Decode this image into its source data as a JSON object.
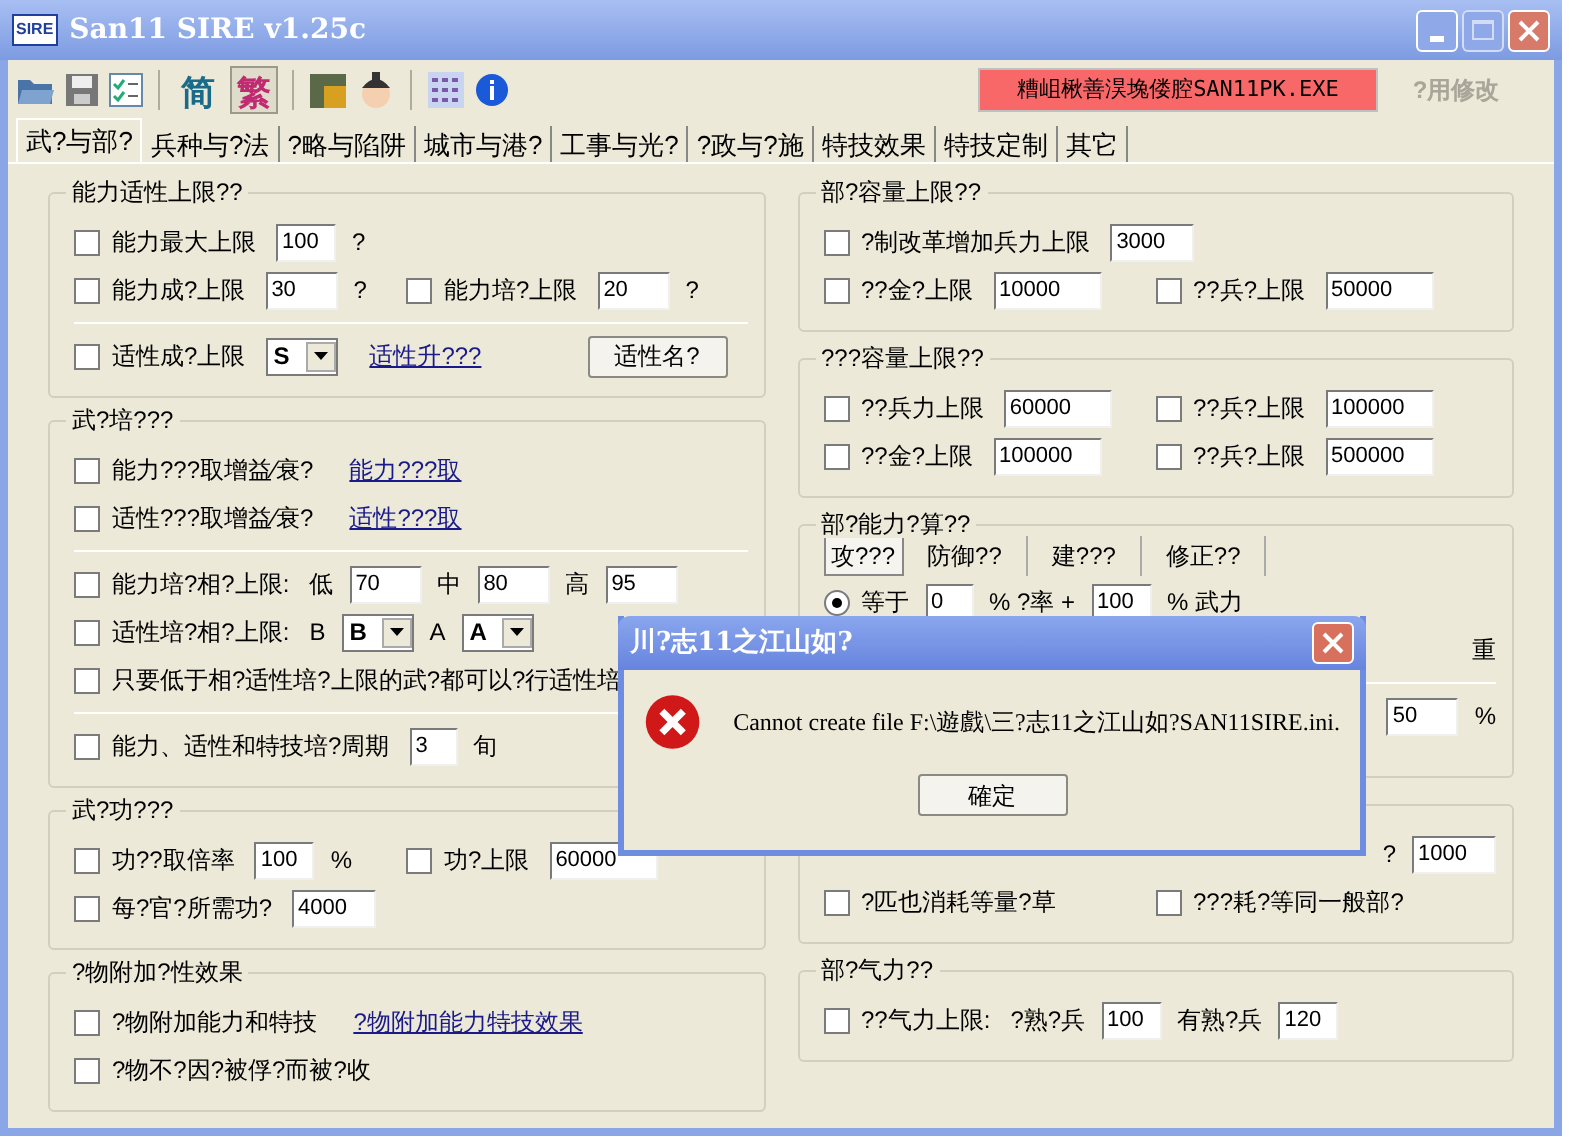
{
  "window": {
    "app_icon": "SIRE",
    "title": "San11 SIRE v1.25c"
  },
  "toolbar": {
    "script_buttons": [
      {
        "text": "简",
        "selected": false
      },
      {
        "text": "繁",
        "selected": true
      }
    ],
    "status_label": "糟岨楸善淏堍偻腔SAN11PK.EXE",
    "apply_button": {
      "label": "?用修改",
      "disabled": true
    }
  },
  "tabs": [
    {
      "label": "武?与部?",
      "selected": true
    },
    {
      "label": "兵种与?法",
      "selected": false
    },
    {
      "label": "?略与陷阱",
      "selected": false
    },
    {
      "label": "城市与港?",
      "selected": false
    },
    {
      "label": "工事与光?",
      "selected": false
    },
    {
      "label": "?政与?施",
      "selected": false
    },
    {
      "label": "特技效果",
      "selected": false
    },
    {
      "label": "特技定制",
      "selected": false
    },
    {
      "label": "其它",
      "selected": false
    }
  ],
  "left_groups": [
    {
      "title": "能力适性上限??",
      "rows": [
        {
          "cells": [
            [
              {
                "kind": "check",
                "label": "能力最大上限",
                "checked": false
              },
              {
                "kind": "field",
                "value": "100"
              },
              {
                "kind": "text",
                "text": "?"
              }
            ]
          ]
        },
        {
          "cells": [
            [
              {
                "kind": "check",
                "label": "能力成?上限",
                "checked": false
              },
              {
                "kind": "field",
                "value": "30"
              },
              {
                "kind": "text",
                "text": "?"
              }
            ],
            [
              {
                "kind": "check",
                "label": "能力培?上限",
                "checked": false
              },
              {
                "kind": "field",
                "value": "20"
              },
              {
                "kind": "text",
                "text": "?"
              }
            ]
          ]
        },
        {
          "kind": "divider"
        },
        {
          "cells": [
            [
              {
                "kind": "check",
                "label": "适性成?上限",
                "checked": false
              },
              {
                "kind": "select",
                "value": "S"
              },
              {
                "kind": "link",
                "text": "适性升???"
              },
              {
                "kind": "button",
                "label": "适性名?"
              }
            ]
          ]
        }
      ]
    },
    {
      "title": "武?培???",
      "rows": [
        {
          "cells": [
            [
              {
                "kind": "check",
                "label": "能力???取增益⁄衰?",
                "checked": false
              },
              {
                "kind": "link",
                "text": "能力???取"
              }
            ]
          ]
        },
        {
          "cells": [
            [
              {
                "kind": "check",
                "label": "适性???取增益⁄衰?",
                "checked": false
              },
              {
                "kind": "link",
                "text": "适性???取"
              }
            ]
          ]
        },
        {
          "kind": "divider"
        },
        {
          "cells": [
            [
              {
                "kind": "check",
                "label": "能力培?相?上限:",
                "checked": false
              },
              {
                "kind": "text",
                "text": "低"
              },
              {
                "kind": "field",
                "value": "70"
              },
              {
                "kind": "text",
                "text": "中"
              },
              {
                "kind": "field",
                "value": "80"
              },
              {
                "kind": "text",
                "text": "高"
              },
              {
                "kind": "field",
                "value": "95"
              }
            ]
          ]
        },
        {
          "cells": [
            [
              {
                "kind": "check",
                "label": "适性培?相?上限:",
                "checked": false
              },
              {
                "kind": "text",
                "text": "B"
              },
              {
                "kind": "select",
                "value": "B"
              },
              {
                "kind": "text",
                "text": "A"
              },
              {
                "kind": "select",
                "value": "A"
              }
            ]
          ]
        },
        {
          "cells": [
            [
              {
                "kind": "check",
                "label": "只要低于相?适性培?上限的武?都可以?行适性培",
                "checked": false
              }
            ]
          ]
        },
        {
          "kind": "divider"
        },
        {
          "cells": [
            [
              {
                "kind": "check",
                "label": "能力、适性和特技培?周期",
                "checked": false
              },
              {
                "kind": "field",
                "value": "3"
              },
              {
                "kind": "text",
                "text": "旬"
              }
            ]
          ]
        }
      ]
    },
    {
      "title": "武?功???",
      "rows": [
        {
          "cells": [
            [
              {
                "kind": "check",
                "label": "功??取倍率",
                "checked": false
              },
              {
                "kind": "field",
                "value": "100"
              },
              {
                "kind": "text",
                "text": "%"
              }
            ],
            [
              {
                "kind": "check",
                "label": "功?上限",
                "checked": false
              },
              {
                "kind": "field",
                "value": "60000"
              }
            ]
          ]
        },
        {
          "cells": [
            [
              {
                "kind": "check",
                "label": "每?官?所需功?",
                "checked": false
              },
              {
                "kind": "field",
                "value": "4000"
              }
            ]
          ]
        }
      ]
    },
    {
      "title": "?物附加?性效果",
      "rows": [
        {
          "cells": [
            [
              {
                "kind": "check",
                "label": "?物附加能力和特技",
                "checked": false
              },
              {
                "kind": "link",
                "text": "?物附加能力特技效果"
              }
            ]
          ]
        },
        {
          "cells": [
            [
              {
                "kind": "check",
                "label": "?物不?因?被俘?而被?收",
                "checked": false
              }
            ]
          ]
        }
      ]
    }
  ],
  "right_groups": [
    {
      "title": "部?容量上限??",
      "rows": [
        {
          "cells": [
            [
              {
                "kind": "check",
                "label": "?制改革增加兵力上限",
                "checked": false
              },
              {
                "kind": "field",
                "value": "3000"
              }
            ]
          ]
        },
        {
          "cells": [
            [
              {
                "kind": "check",
                "label": "??金?上限",
                "checked": false
              },
              {
                "kind": "field",
                "value": "10000"
              }
            ],
            [
              {
                "kind": "check",
                "label": "??兵?上限",
                "checked": false
              },
              {
                "kind": "field",
                "value": "50000"
              }
            ]
          ]
        }
      ]
    },
    {
      "title": "???容量上限??",
      "rows": [
        {
          "cells": [
            [
              {
                "kind": "check",
                "label": "??兵力上限",
                "checked": false
              },
              {
                "kind": "field",
                "value": "60000"
              }
            ],
            [
              {
                "kind": "check",
                "label": "??兵?上限",
                "checked": false
              },
              {
                "kind": "field",
                "value": "100000"
              }
            ]
          ]
        },
        {
          "cells": [
            [
              {
                "kind": "check",
                "label": "??金?上限",
                "checked": false
              },
              {
                "kind": "field",
                "value": "100000"
              }
            ],
            [
              {
                "kind": "check",
                "label": "??兵?上限",
                "checked": false
              },
              {
                "kind": "field",
                "value": "500000"
              }
            ]
          ]
        }
      ]
    },
    {
      "title": "部?能力?算??",
      "subtabs": [
        {
          "label": "攻???",
          "selected": true
        },
        {
          "label": "防御??",
          "selected": false
        },
        {
          "label": "建???",
          "selected": false
        },
        {
          "label": "修正??",
          "selected": false
        }
      ],
      "rows": [
        {
          "cells": [
            [
              {
                "kind": "radio",
                "label": "等于",
                "selected": true
              },
              {
                "kind": "field",
                "value": "0"
              },
              {
                "kind": "text",
                "text": "% ?率 +"
              },
              {
                "kind": "field",
                "value": "100"
              },
              {
                "kind": "text",
                "text": "% 武力"
              }
            ]
          ]
        },
        {
          "kind": "trailing",
          "cells": [
            [
              {
                "kind": "text",
                "text": "重"
              }
            ]
          ]
        },
        {
          "kind": "divider"
        },
        {
          "kind": "trailing",
          "cells": [
            [
              {
                "kind": "field",
                "value": "50"
              },
              {
                "kind": "text",
                "text": "%"
              }
            ]
          ]
        }
      ]
    },
    {
      "rows": [
        {
          "kind": "trailing",
          "cells": [
            [
              {
                "kind": "text",
                "text": "?"
              },
              {
                "kind": "field",
                "value": "1000"
              }
            ]
          ]
        },
        {
          "cells": [
            [
              {
                "kind": "check",
                "label": "?匹也消耗等量?草",
                "checked": false
              }
            ],
            [
              {
                "kind": "check",
                "label": "???耗?等同一般部?",
                "checked": false
              }
            ]
          ]
        }
      ]
    },
    {
      "title": "部?气力??",
      "rows": [
        {
          "cells": [
            [
              {
                "kind": "check",
                "label": "??气力上限:",
                "checked": false
              },
              {
                "kind": "text",
                "text": "?熟?兵"
              },
              {
                "kind": "field",
                "value": "100"
              },
              {
                "kind": "text",
                "text": "有熟?兵"
              },
              {
                "kind": "field",
                "value": "120"
              }
            ]
          ]
        }
      ]
    }
  ],
  "dialog": {
    "title": "川?志11之江山如?",
    "message": "Cannot create file F:\\遊戲\\三?志11之江山如?SAN11SIRE.ini.",
    "button": "確定"
  }
}
